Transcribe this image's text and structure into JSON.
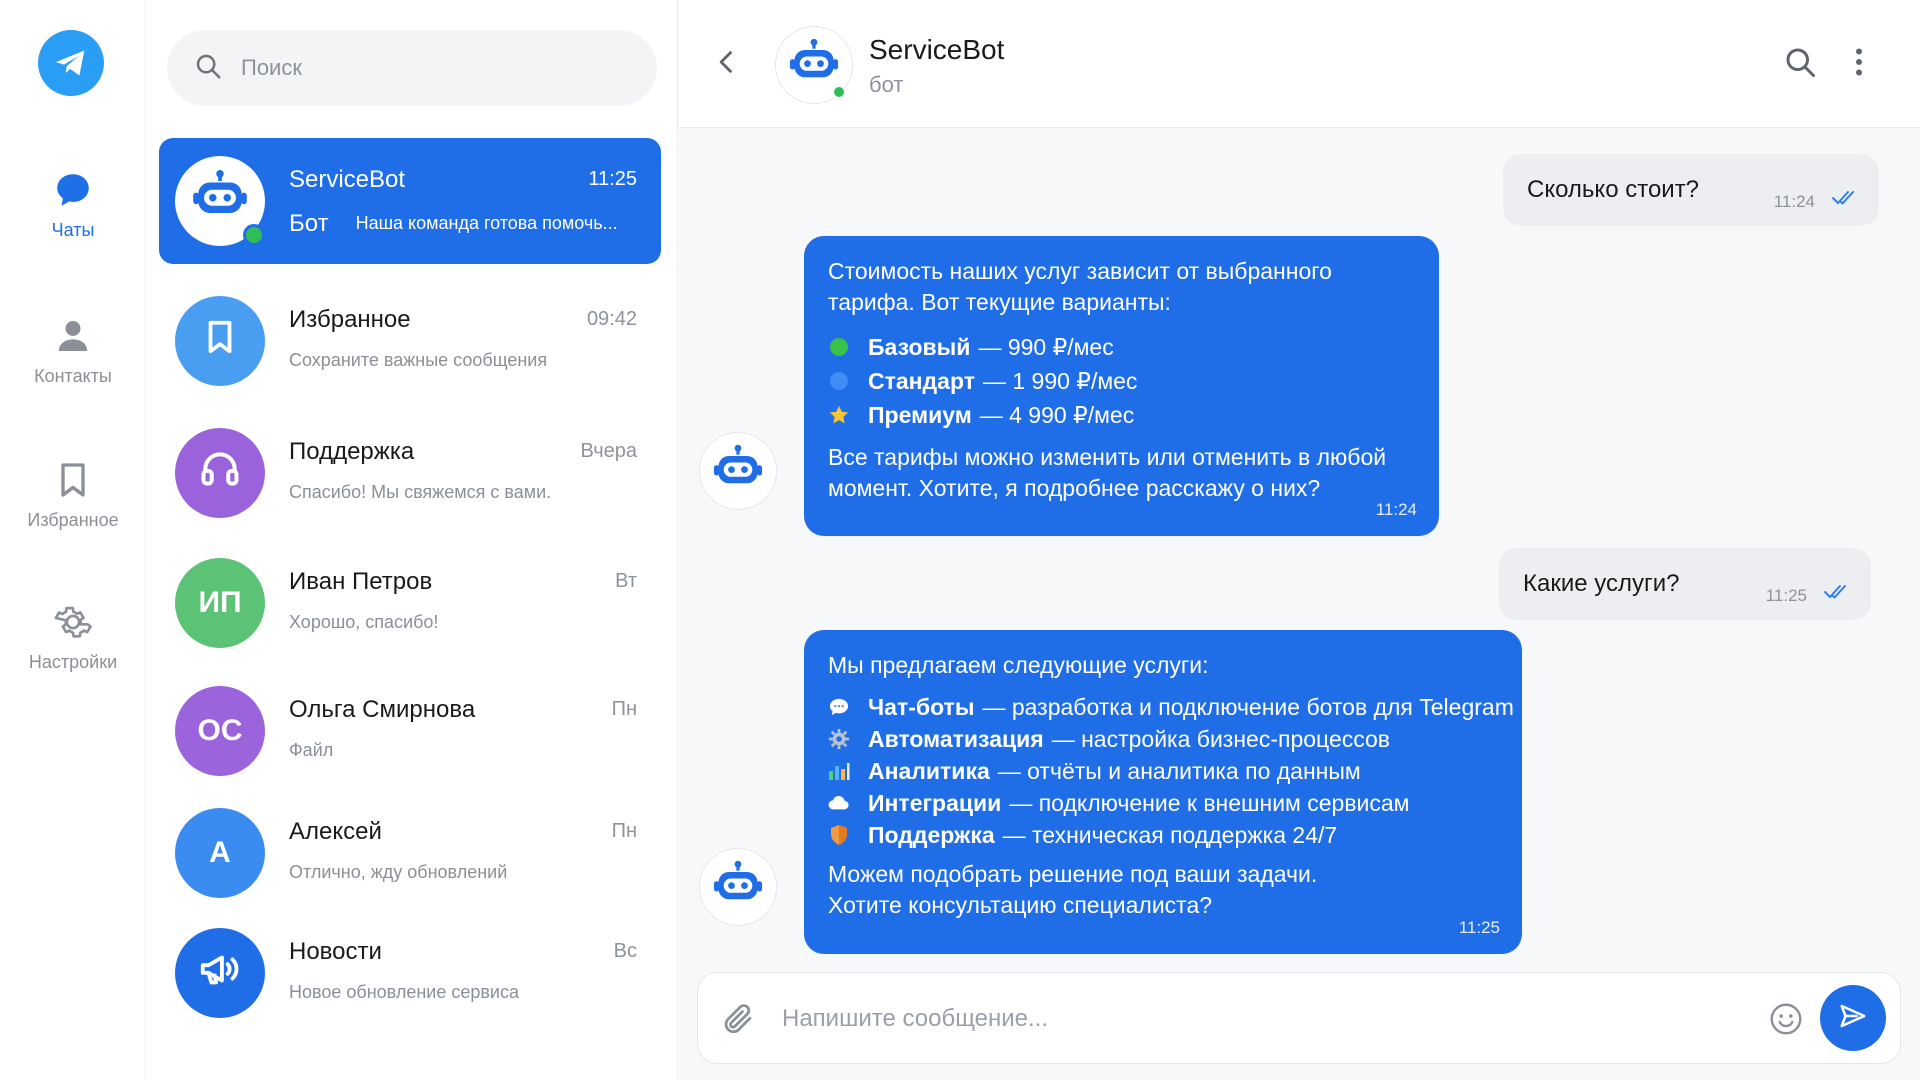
{
  "colors": {
    "accent": "#1f6ee8",
    "online": "#2fbd5a",
    "logo": "#2a9df4"
  },
  "nav": {
    "items": [
      {
        "label": "Чаты",
        "icon": "chat-bubble-icon"
      },
      {
        "label": "Контакты",
        "icon": "person-icon"
      },
      {
        "label": "Избранное",
        "icon": "bookmark-icon"
      },
      {
        "label": "Настройки",
        "icon": "gear-icon"
      }
    ]
  },
  "search": {
    "placeholder": "Поиск"
  },
  "chats": [
    {
      "name": "ServiceBot",
      "time": "11:25",
      "tag": "Бот",
      "preview": "Наша команда готова помочь..."
    },
    {
      "name": "Избранное",
      "time": "09:42",
      "preview": "Сохраните важные сообщения"
    },
    {
      "name": "Поддержка",
      "time": "Вчера",
      "preview": "Спасибо! Мы свяжемся с вами."
    },
    {
      "name": "Иван Петров",
      "time": "Вт",
      "preview": "Хорошо, спасибо!",
      "initials": "ИП"
    },
    {
      "name": "Ольга Смирнова",
      "time": "Пн",
      "preview": "Файл",
      "initials": "ОС"
    },
    {
      "name": "Алексей",
      "time": "Пн",
      "preview": "Отлично, жду обновлений",
      "initials": "А"
    },
    {
      "name": "Новости",
      "time": "Вс",
      "preview": "Новое обновление сервиса"
    }
  ],
  "header": {
    "name": "ServiceBot",
    "status": "бот"
  },
  "messages": {
    "m1": {
      "text": "Сколько стоит?",
      "time": "11:24"
    },
    "m2": {
      "intro": "Стоимость наших услуг зависит от выбранного тарифа. Вот текущие варианты:",
      "items": [
        {
          "name": "Базовый",
          "rest": "— 990 ₽/мес",
          "icon": "green-circle-icon"
        },
        {
          "name": "Стандарт",
          "rest": "— 1 990 ₽/мес",
          "icon": "blue-circle-icon"
        },
        {
          "name": "Премиум",
          "rest": "— 4 990 ₽/мес",
          "icon": "star-icon"
        }
      ],
      "outro": "Все тарифы можно изменить или отменить в любой момент. Хотите, я подробнее расскажу о них?",
      "time": "11:24"
    },
    "m3": {
      "text": "Какие услуги?",
      "time": "11:25"
    },
    "m4": {
      "intro": "Мы предлагаем следующие услуги:",
      "items": [
        {
          "name": "Чат-боты",
          "rest": "— разработка и подключение ботов для Telegram",
          "icon": "speech-bubble-icon"
        },
        {
          "name": "Автоматизация",
          "rest": "— настройка бизнес-процессов",
          "icon": "gear-icon"
        },
        {
          "name": "Аналитика",
          "rest": "— отчёты и аналитика по данным",
          "icon": "bar-chart-icon"
        },
        {
          "name": "Интеграции",
          "rest": "— подключение к внешним сервисам",
          "icon": "cloud-icon"
        },
        {
          "name": "Поддержка",
          "rest": "— техническая поддержка 24/7",
          "icon": "shield-icon"
        }
      ],
      "outro": "Можем подобрать решение под ваши задачи. Хотите консультацию специалиста?",
      "time": "11:25"
    }
  },
  "composer": {
    "placeholder": "Напишите сообщение..."
  }
}
